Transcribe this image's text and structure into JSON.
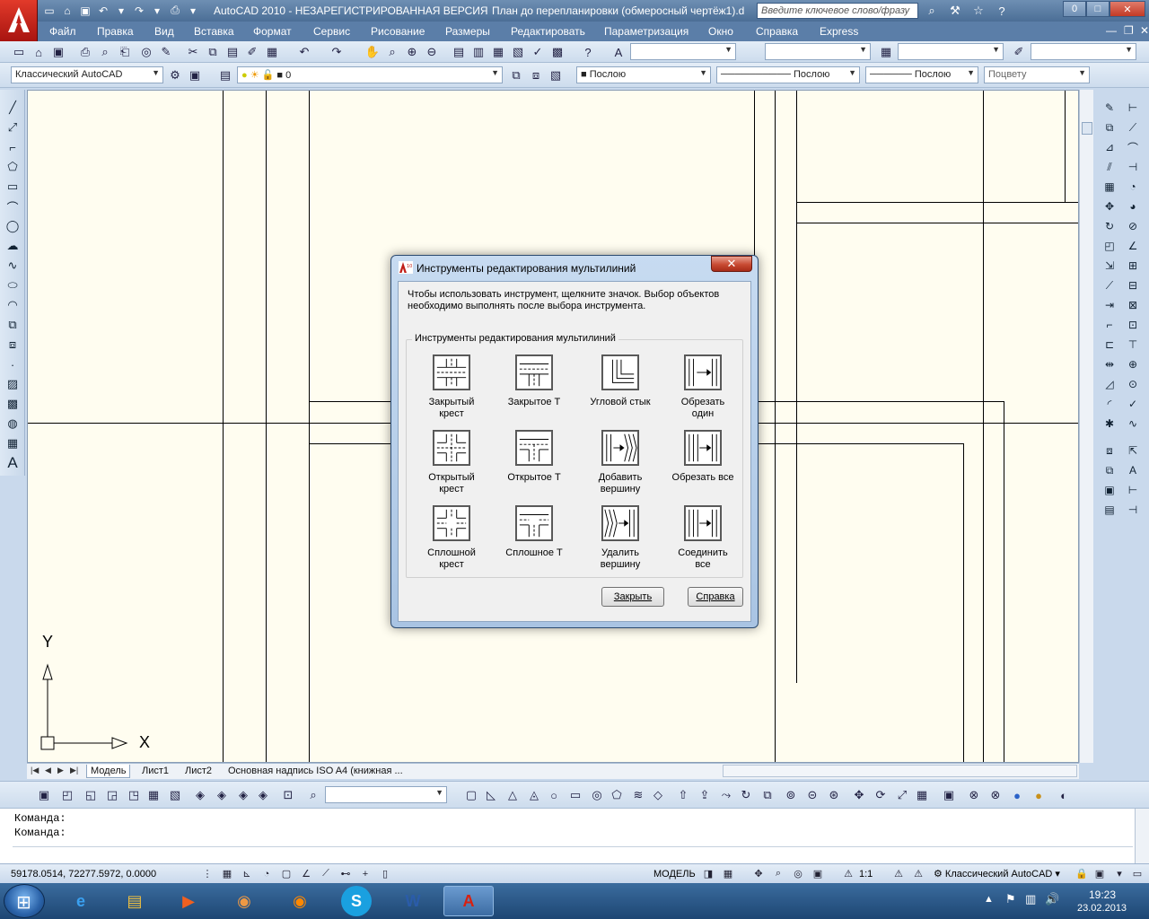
{
  "titlebar": {
    "app_title": "AutoCAD 2010 - НЕЗАРЕГИСТРИРОВАННАЯ ВЕРСИЯ",
    "doc_title": "План до перепланировки (обмеросный чертёж1).d",
    "search_placeholder": "Введите ключевое слово/фразу",
    "minimize": "0",
    "restore": "□",
    "close": "✕"
  },
  "menu": {
    "items": [
      "Файл",
      "Правка",
      "Вид",
      "Вставка",
      "Формат",
      "Сервис",
      "Рисование",
      "Размеры",
      "Редактировать",
      "Параметризация",
      "Окно",
      "Справка",
      "Express"
    ]
  },
  "toolbars": {
    "workspace": "Классический AutoCAD",
    "layer": "0",
    "color": "Послою",
    "linetype": "Послою",
    "lineweight": "Послою",
    "plotstyle": "Поцвету"
  },
  "tabs": {
    "model": "Модель",
    "sheet1": "Лист1",
    "sheet2": "Лист2",
    "titleblock": "Основная надпись ISO A4 (книжная ..."
  },
  "ucs": {
    "y": "Y",
    "x": "X"
  },
  "command": {
    "line1": "Команда:",
    "line2": "Команда:"
  },
  "status": {
    "coords": "59178.0514, 72277.5972, 0.0000",
    "model": "МОДЕЛЬ",
    "scale": "1:1",
    "workspace": "Классический AutoCAD"
  },
  "taskbar": {
    "time": "19:23",
    "date": "23.02.2013"
  },
  "dialog": {
    "title": "Инструменты редактирования мультилиний",
    "instruction": "Чтобы использовать инструмент, щелкните значок.  Выбор объектов необходимо выполнять после выбора инструмента.",
    "group_label": "Инструменты редактирования мультилиний",
    "tools": [
      {
        "line1": "Закрытый",
        "line2": "крест"
      },
      {
        "line1": "Закрытое Т",
        "line2": ""
      },
      {
        "line1": "Угловой стык",
        "line2": ""
      },
      {
        "line1": "Обрезать",
        "line2": "один"
      },
      {
        "line1": "Открытый",
        "line2": "крест"
      },
      {
        "line1": "Открытое Т",
        "line2": ""
      },
      {
        "line1": "Добавить",
        "line2": "вершину"
      },
      {
        "line1": "Обрезать все",
        "line2": ""
      },
      {
        "line1": "Сплошной",
        "line2": "крест"
      },
      {
        "line1": "Сплошное Т",
        "line2": ""
      },
      {
        "line1": "Удалить",
        "line2": "вершину"
      },
      {
        "line1": "Соединить",
        "line2": "все"
      }
    ],
    "close_button": "Закрыть",
    "help_button": "Справка"
  },
  "colors": {
    "drawing_bg": "#fffdf0",
    "title_bar": "#4b6e96",
    "menu_bar": "#5b7ea8",
    "dialog_frame": "#a9c4e3"
  }
}
